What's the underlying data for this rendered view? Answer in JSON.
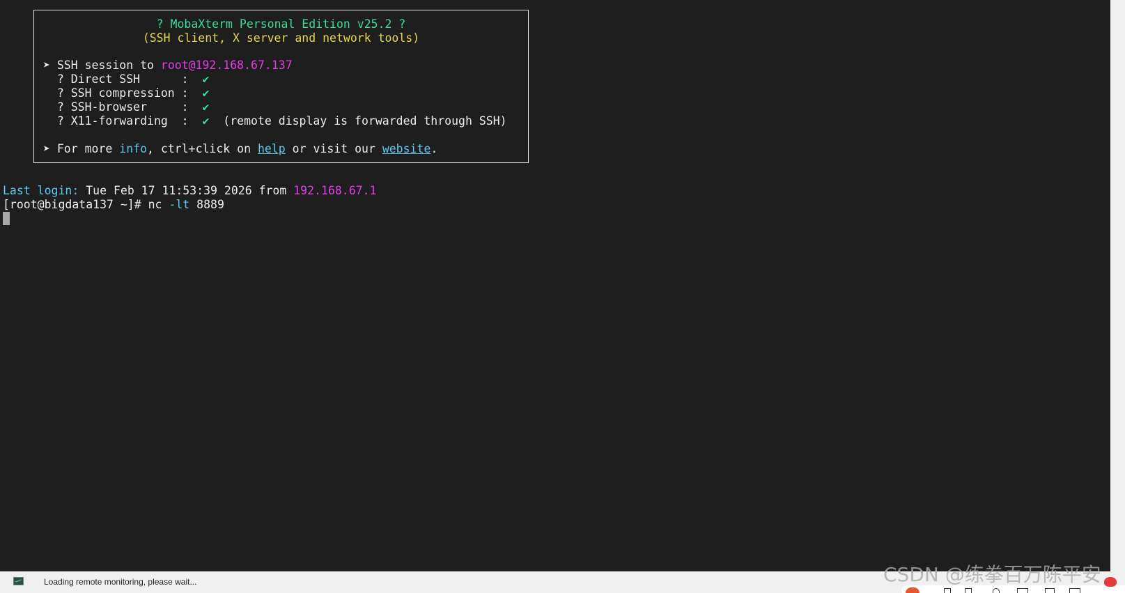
{
  "banner": {
    "title": "? MobaXterm Personal Edition v25.2 ?",
    "subtitle": "(SSH client, X server and network tools)",
    "session_prefix": "➤ SSH session to ",
    "session_host": "root@192.168.67.137",
    "features": [
      {
        "label": "  ? Direct SSH      :  ",
        "check": "✔",
        "note": ""
      },
      {
        "label": "  ? SSH compression :  ",
        "check": "✔",
        "note": ""
      },
      {
        "label": "  ? SSH-browser     :  ",
        "check": "✔",
        "note": ""
      },
      {
        "label": "  ? X11-forwarding  :  ",
        "check": "✔",
        "note": "  (remote display is forwarded through SSH)"
      }
    ],
    "more_prefix": "➤ For more ",
    "more_info": "info",
    "more_mid1": ", ctrl+click on ",
    "more_help": "help",
    "more_mid2": " or visit our ",
    "more_website": "website",
    "more_end": "."
  },
  "terminal": {
    "last_login_label": "Last login:",
    "last_login_value": " Tue Feb 17 11:53:39 2026 from ",
    "last_login_ip": "192.168.67.1",
    "prompt": "[root@bigdata137 ~]# ",
    "command": "nc",
    "command_flag": " -lt",
    "command_arg": " 8889"
  },
  "statusbar": {
    "icon": "monitor-icon",
    "text": "Loading remote monitoring, please wait..."
  },
  "watermark": {
    "text": "CSDN @练拳百万陈平安"
  },
  "colors": {
    "background": "#1e1e1e",
    "green": "#3ddc97",
    "yellow": "#e6d94a",
    "magenta": "#e33ee6",
    "cyan": "#5ac8f0"
  }
}
